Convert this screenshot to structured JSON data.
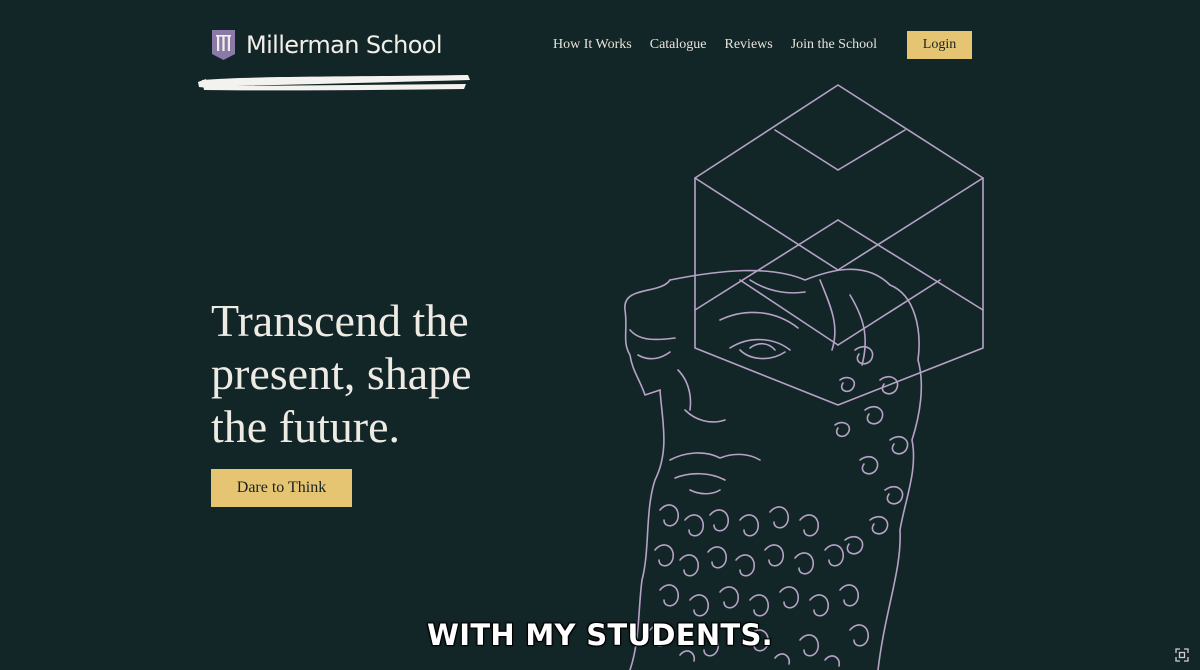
{
  "header": {
    "brand": "Millerman School",
    "nav": [
      {
        "label": "How It Works"
      },
      {
        "label": "Catalogue"
      },
      {
        "label": "Reviews"
      },
      {
        "label": "Join the School"
      }
    ],
    "login_label": "Login"
  },
  "hero": {
    "title": "Transcend the\npresent, shape\nthe future.",
    "cta_label": "Dare to Think"
  },
  "caption": "WITH MY STUDENTS.",
  "colors": {
    "background": "#132627",
    "accent": "#e5c472",
    "brand_purple": "#8b79a8",
    "line_art": "#b7a2c7",
    "text": "#eeebe4"
  },
  "icons": {
    "logo": "shield-logo-icon",
    "art": "philosopher-bust-illustration",
    "fullscreen": "fullscreen-icon"
  }
}
